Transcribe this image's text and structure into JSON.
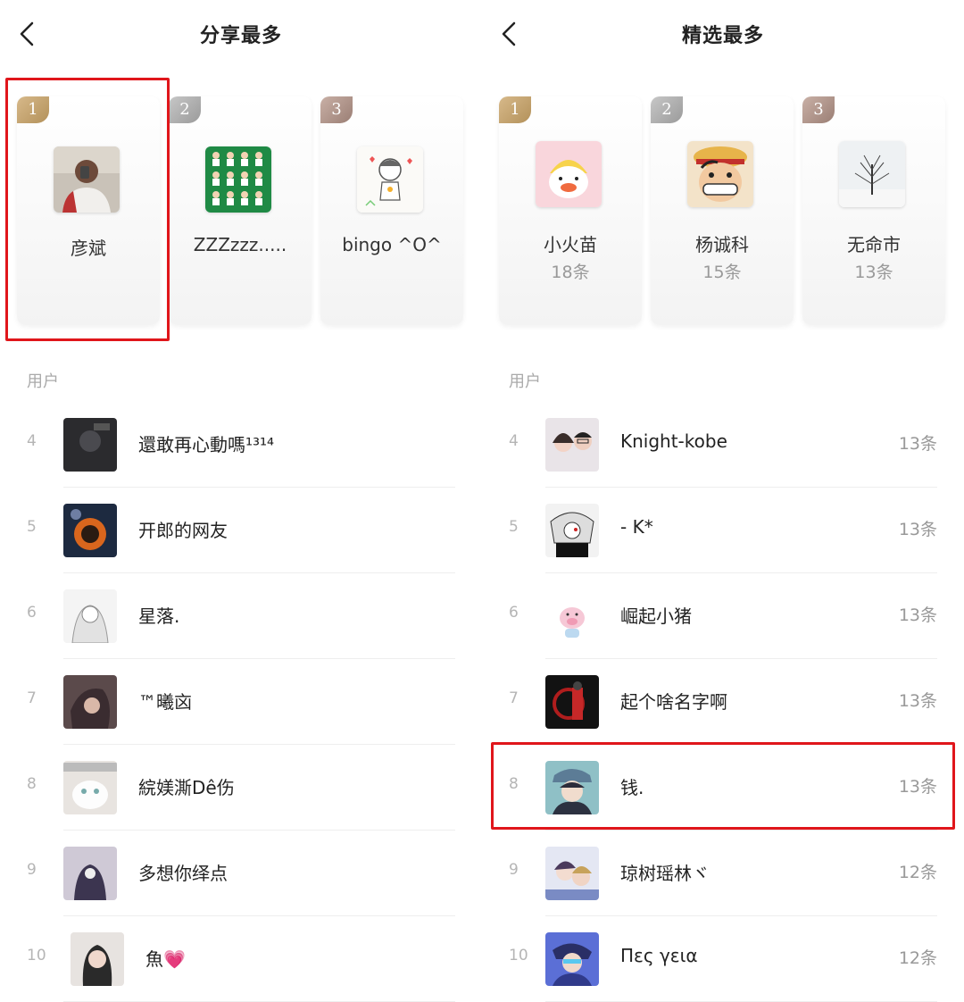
{
  "left_panel": {
    "title": "分享最多",
    "top3": [
      {
        "rank": "1",
        "name": "彦斌",
        "count": ""
      },
      {
        "rank": "2",
        "name": "ZZZzzz.....",
        "count": ""
      },
      {
        "rank": "3",
        "name": "bingo ^O^",
        "count": ""
      }
    ],
    "section_label": "用户",
    "list": [
      {
        "rank": "4",
        "name": "還敢再心動嗎¹³¹⁴",
        "count": ""
      },
      {
        "rank": "5",
        "name": "开郎的网友",
        "count": ""
      },
      {
        "rank": "6",
        "name": "星落.",
        "count": ""
      },
      {
        "rank": "7",
        "name": "™曦㐫",
        "count": ""
      },
      {
        "rank": "8",
        "name": "綄媄澌Dê伤",
        "count": ""
      },
      {
        "rank": "9",
        "name": "多想你绎点",
        "count": ""
      },
      {
        "rank": "10",
        "name": "魚💗",
        "count": ""
      }
    ]
  },
  "right_panel": {
    "title": "精选最多",
    "top3": [
      {
        "rank": "1",
        "name": "小火苗",
        "count": "18条"
      },
      {
        "rank": "2",
        "name": "杨诚科",
        "count": "15条"
      },
      {
        "rank": "3",
        "name": "无命市",
        "count": "13条"
      }
    ],
    "section_label": "用户",
    "list": [
      {
        "rank": "4",
        "name": "Knight-kobe",
        "count": "13条"
      },
      {
        "rank": "5",
        "name": "- K*",
        "count": "13条"
      },
      {
        "rank": "6",
        "name": "崛起小猪",
        "count": "13条"
      },
      {
        "rank": "7",
        "name": "起个啥名字啊",
        "count": "13条"
      },
      {
        "rank": "8",
        "name": "钱.",
        "count": "13条"
      },
      {
        "rank": "9",
        "name": "琼树瑶林ヾ",
        "count": "12条"
      },
      {
        "rank": "10",
        "name": "Πες γεια",
        "count": "12条"
      }
    ]
  },
  "colors": {
    "highlight": "#e0161b",
    "rank_gold": "#c4a46f",
    "rank_silver": "#b0b0b0",
    "rank_bronze": "#b0958b"
  }
}
